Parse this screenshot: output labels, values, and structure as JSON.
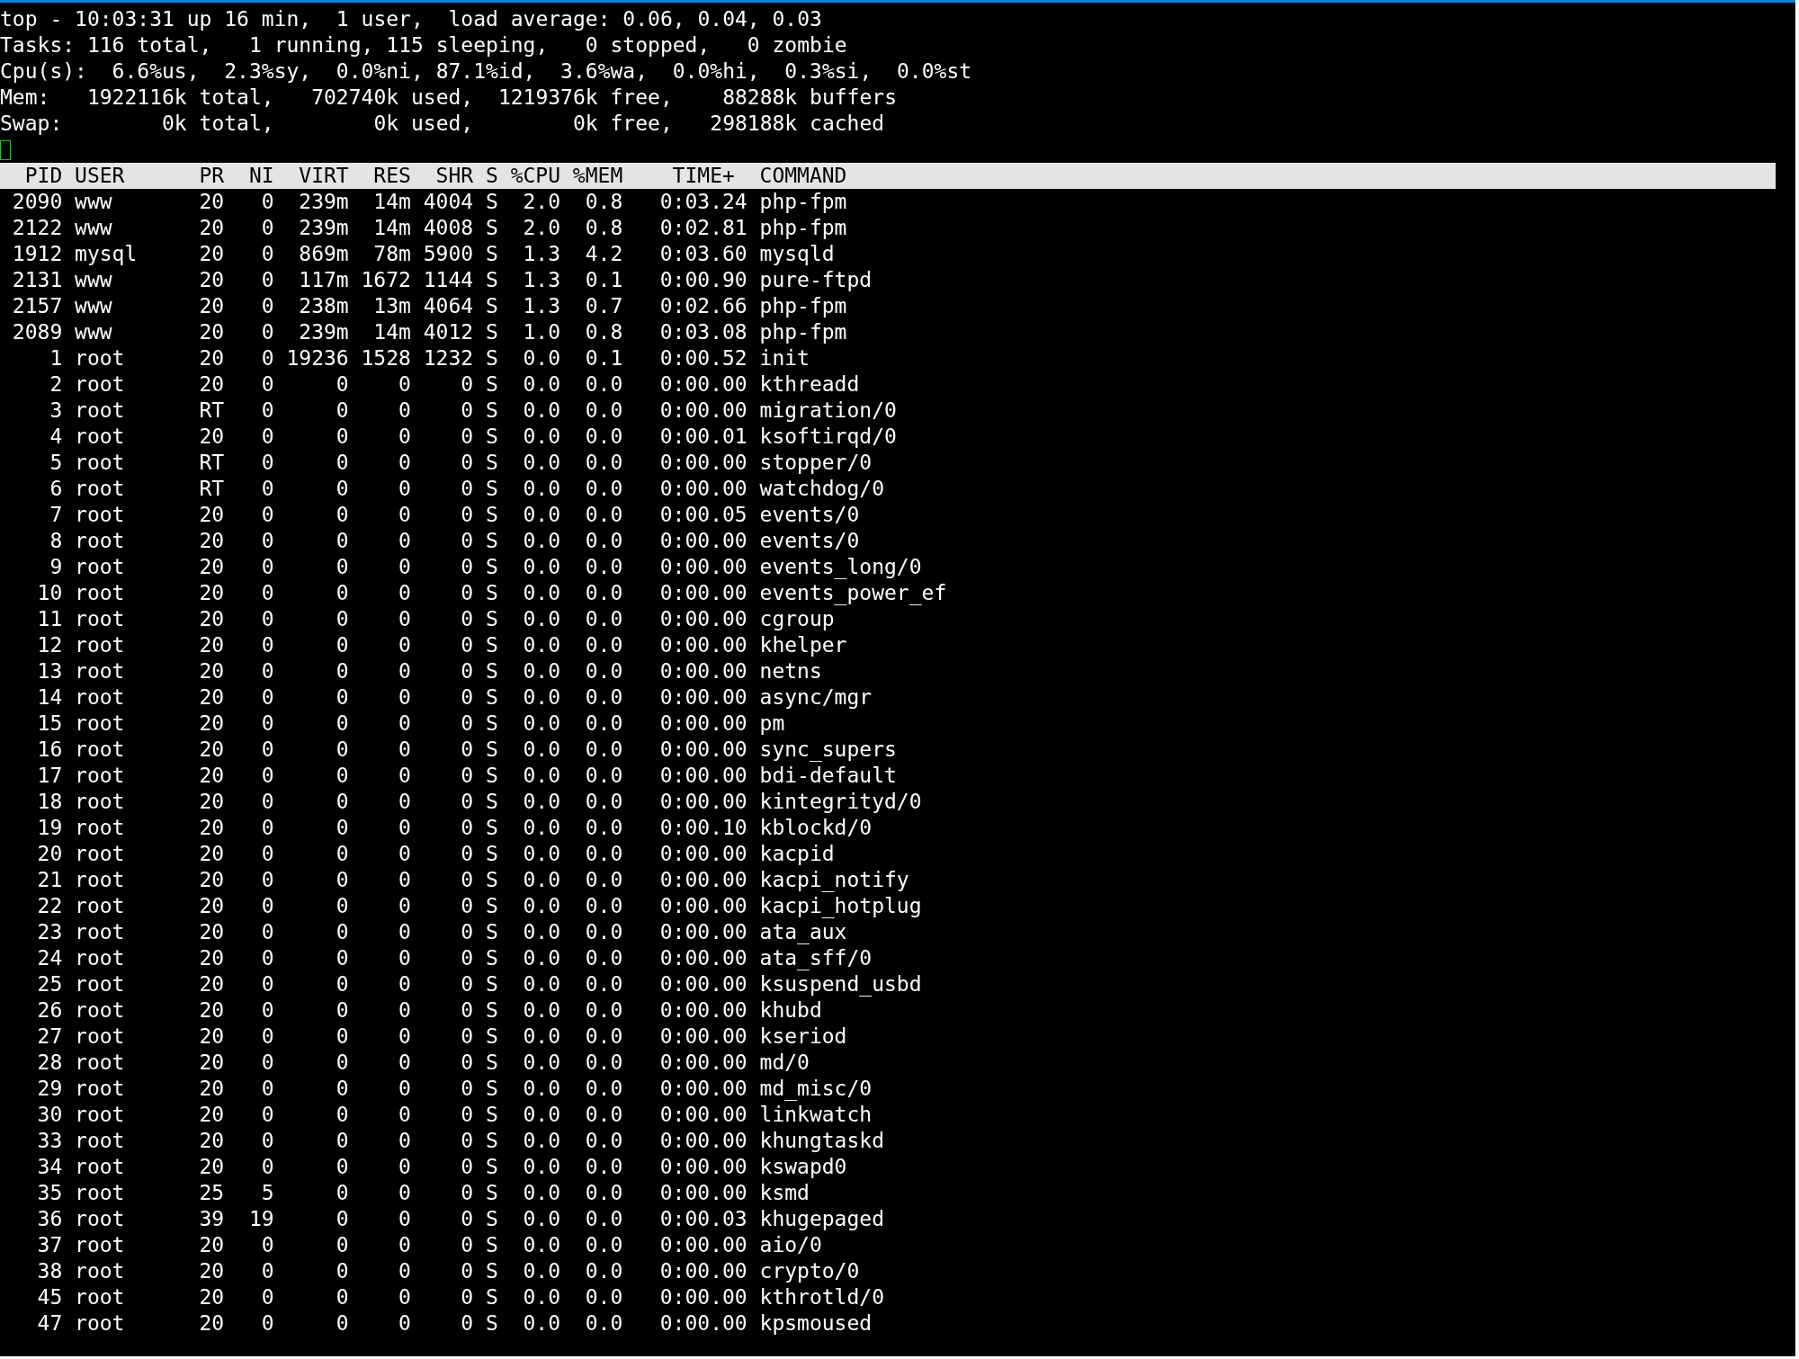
{
  "summary": {
    "lines": [
      "top - 10:03:31 up 16 min,  1 user,  load average: 0.06, 0.04, 0.03",
      "Tasks: 116 total,   1 running, 115 sleeping,   0 stopped,   0 zombie",
      "Cpu(s):  6.6%us,  2.3%sy,  0.0%ni, 87.1%id,  3.6%wa,  0.0%hi,  0.3%si,  0.0%st",
      "Mem:   1922116k total,   702740k used,  1219376k free,    88288k buffers",
      "Swap:        0k total,        0k used,        0k free,   298188k cached"
    ]
  },
  "process_table": {
    "columns": [
      "PID",
      "USER",
      "PR",
      "NI",
      "VIRT",
      "RES",
      "SHR",
      "S",
      "%CPU",
      "%MEM",
      "TIME+",
      "COMMAND"
    ],
    "rows": [
      [
        "2090",
        "www",
        "20",
        "0",
        "239m",
        "14m",
        "4004",
        "S",
        "2.0",
        "0.8",
        "0:03.24",
        "php-fpm"
      ],
      [
        "2122",
        "www",
        "20",
        "0",
        "239m",
        "14m",
        "4008",
        "S",
        "2.0",
        "0.8",
        "0:02.81",
        "php-fpm"
      ],
      [
        "1912",
        "mysql",
        "20",
        "0",
        "869m",
        "78m",
        "5900",
        "S",
        "1.3",
        "4.2",
        "0:03.60",
        "mysqld"
      ],
      [
        "2131",
        "www",
        "20",
        "0",
        "117m",
        "1672",
        "1144",
        "S",
        "1.3",
        "0.1",
        "0:00.90",
        "pure-ftpd"
      ],
      [
        "2157",
        "www",
        "20",
        "0",
        "238m",
        "13m",
        "4064",
        "S",
        "1.3",
        "0.7",
        "0:02.66",
        "php-fpm"
      ],
      [
        "2089",
        "www",
        "20",
        "0",
        "239m",
        "14m",
        "4012",
        "S",
        "1.0",
        "0.8",
        "0:03.08",
        "php-fpm"
      ],
      [
        "1",
        "root",
        "20",
        "0",
        "19236",
        "1528",
        "1232",
        "S",
        "0.0",
        "0.1",
        "0:00.52",
        "init"
      ],
      [
        "2",
        "root",
        "20",
        "0",
        "0",
        "0",
        "0",
        "S",
        "0.0",
        "0.0",
        "0:00.00",
        "kthreadd"
      ],
      [
        "3",
        "root",
        "RT",
        "0",
        "0",
        "0",
        "0",
        "S",
        "0.0",
        "0.0",
        "0:00.00",
        "migration/0"
      ],
      [
        "4",
        "root",
        "20",
        "0",
        "0",
        "0",
        "0",
        "S",
        "0.0",
        "0.0",
        "0:00.01",
        "ksoftirqd/0"
      ],
      [
        "5",
        "root",
        "RT",
        "0",
        "0",
        "0",
        "0",
        "S",
        "0.0",
        "0.0",
        "0:00.00",
        "stopper/0"
      ],
      [
        "6",
        "root",
        "RT",
        "0",
        "0",
        "0",
        "0",
        "S",
        "0.0",
        "0.0",
        "0:00.00",
        "watchdog/0"
      ],
      [
        "7",
        "root",
        "20",
        "0",
        "0",
        "0",
        "0",
        "S",
        "0.0",
        "0.0",
        "0:00.05",
        "events/0"
      ],
      [
        "8",
        "root",
        "20",
        "0",
        "0",
        "0",
        "0",
        "S",
        "0.0",
        "0.0",
        "0:00.00",
        "events/0"
      ],
      [
        "9",
        "root",
        "20",
        "0",
        "0",
        "0",
        "0",
        "S",
        "0.0",
        "0.0",
        "0:00.00",
        "events_long/0"
      ],
      [
        "10",
        "root",
        "20",
        "0",
        "0",
        "0",
        "0",
        "S",
        "0.0",
        "0.0",
        "0:00.00",
        "events_power_ef"
      ],
      [
        "11",
        "root",
        "20",
        "0",
        "0",
        "0",
        "0",
        "S",
        "0.0",
        "0.0",
        "0:00.00",
        "cgroup"
      ],
      [
        "12",
        "root",
        "20",
        "0",
        "0",
        "0",
        "0",
        "S",
        "0.0",
        "0.0",
        "0:00.00",
        "khelper"
      ],
      [
        "13",
        "root",
        "20",
        "0",
        "0",
        "0",
        "0",
        "S",
        "0.0",
        "0.0",
        "0:00.00",
        "netns"
      ],
      [
        "14",
        "root",
        "20",
        "0",
        "0",
        "0",
        "0",
        "S",
        "0.0",
        "0.0",
        "0:00.00",
        "async/mgr"
      ],
      [
        "15",
        "root",
        "20",
        "0",
        "0",
        "0",
        "0",
        "S",
        "0.0",
        "0.0",
        "0:00.00",
        "pm"
      ],
      [
        "16",
        "root",
        "20",
        "0",
        "0",
        "0",
        "0",
        "S",
        "0.0",
        "0.0",
        "0:00.00",
        "sync_supers"
      ],
      [
        "17",
        "root",
        "20",
        "0",
        "0",
        "0",
        "0",
        "S",
        "0.0",
        "0.0",
        "0:00.00",
        "bdi-default"
      ],
      [
        "18",
        "root",
        "20",
        "0",
        "0",
        "0",
        "0",
        "S",
        "0.0",
        "0.0",
        "0:00.00",
        "kintegrityd/0"
      ],
      [
        "19",
        "root",
        "20",
        "0",
        "0",
        "0",
        "0",
        "S",
        "0.0",
        "0.0",
        "0:00.10",
        "kblockd/0"
      ],
      [
        "20",
        "root",
        "20",
        "0",
        "0",
        "0",
        "0",
        "S",
        "0.0",
        "0.0",
        "0:00.00",
        "kacpid"
      ],
      [
        "21",
        "root",
        "20",
        "0",
        "0",
        "0",
        "0",
        "S",
        "0.0",
        "0.0",
        "0:00.00",
        "kacpi_notify"
      ],
      [
        "22",
        "root",
        "20",
        "0",
        "0",
        "0",
        "0",
        "S",
        "0.0",
        "0.0",
        "0:00.00",
        "kacpi_hotplug"
      ],
      [
        "23",
        "root",
        "20",
        "0",
        "0",
        "0",
        "0",
        "S",
        "0.0",
        "0.0",
        "0:00.00",
        "ata_aux"
      ],
      [
        "24",
        "root",
        "20",
        "0",
        "0",
        "0",
        "0",
        "S",
        "0.0",
        "0.0",
        "0:00.00",
        "ata_sff/0"
      ],
      [
        "25",
        "root",
        "20",
        "0",
        "0",
        "0",
        "0",
        "S",
        "0.0",
        "0.0",
        "0:00.00",
        "ksuspend_usbd"
      ],
      [
        "26",
        "root",
        "20",
        "0",
        "0",
        "0",
        "0",
        "S",
        "0.0",
        "0.0",
        "0:00.00",
        "khubd"
      ],
      [
        "27",
        "root",
        "20",
        "0",
        "0",
        "0",
        "0",
        "S",
        "0.0",
        "0.0",
        "0:00.00",
        "kseriod"
      ],
      [
        "28",
        "root",
        "20",
        "0",
        "0",
        "0",
        "0",
        "S",
        "0.0",
        "0.0",
        "0:00.00",
        "md/0"
      ],
      [
        "29",
        "root",
        "20",
        "0",
        "0",
        "0",
        "0",
        "S",
        "0.0",
        "0.0",
        "0:00.00",
        "md_misc/0"
      ],
      [
        "30",
        "root",
        "20",
        "0",
        "0",
        "0",
        "0",
        "S",
        "0.0",
        "0.0",
        "0:00.00",
        "linkwatch"
      ],
      [
        "33",
        "root",
        "20",
        "0",
        "0",
        "0",
        "0",
        "S",
        "0.0",
        "0.0",
        "0:00.00",
        "khungtaskd"
      ],
      [
        "34",
        "root",
        "20",
        "0",
        "0",
        "0",
        "0",
        "S",
        "0.0",
        "0.0",
        "0:00.00",
        "kswapd0"
      ],
      [
        "35",
        "root",
        "25",
        "5",
        "0",
        "0",
        "0",
        "S",
        "0.0",
        "0.0",
        "0:00.00",
        "ksmd"
      ],
      [
        "36",
        "root",
        "39",
        "19",
        "0",
        "0",
        "0",
        "S",
        "0.0",
        "0.0",
        "0:00.03",
        "khugepaged"
      ],
      [
        "37",
        "root",
        "20",
        "0",
        "0",
        "0",
        "0",
        "S",
        "0.0",
        "0.0",
        "0:00.00",
        "aio/0"
      ],
      [
        "38",
        "root",
        "20",
        "0",
        "0",
        "0",
        "0",
        "S",
        "0.0",
        "0.0",
        "0:00.00",
        "crypto/0"
      ],
      [
        "45",
        "root",
        "20",
        "0",
        "0",
        "0",
        "0",
        "S",
        "0.0",
        "0.0",
        "0:00.00",
        "kthrotld/0"
      ],
      [
        "47",
        "root",
        "20",
        "0",
        "0",
        "0",
        "0",
        "S",
        "0.0",
        "0.0",
        "0:00.00",
        "kpsmoused"
      ]
    ]
  }
}
